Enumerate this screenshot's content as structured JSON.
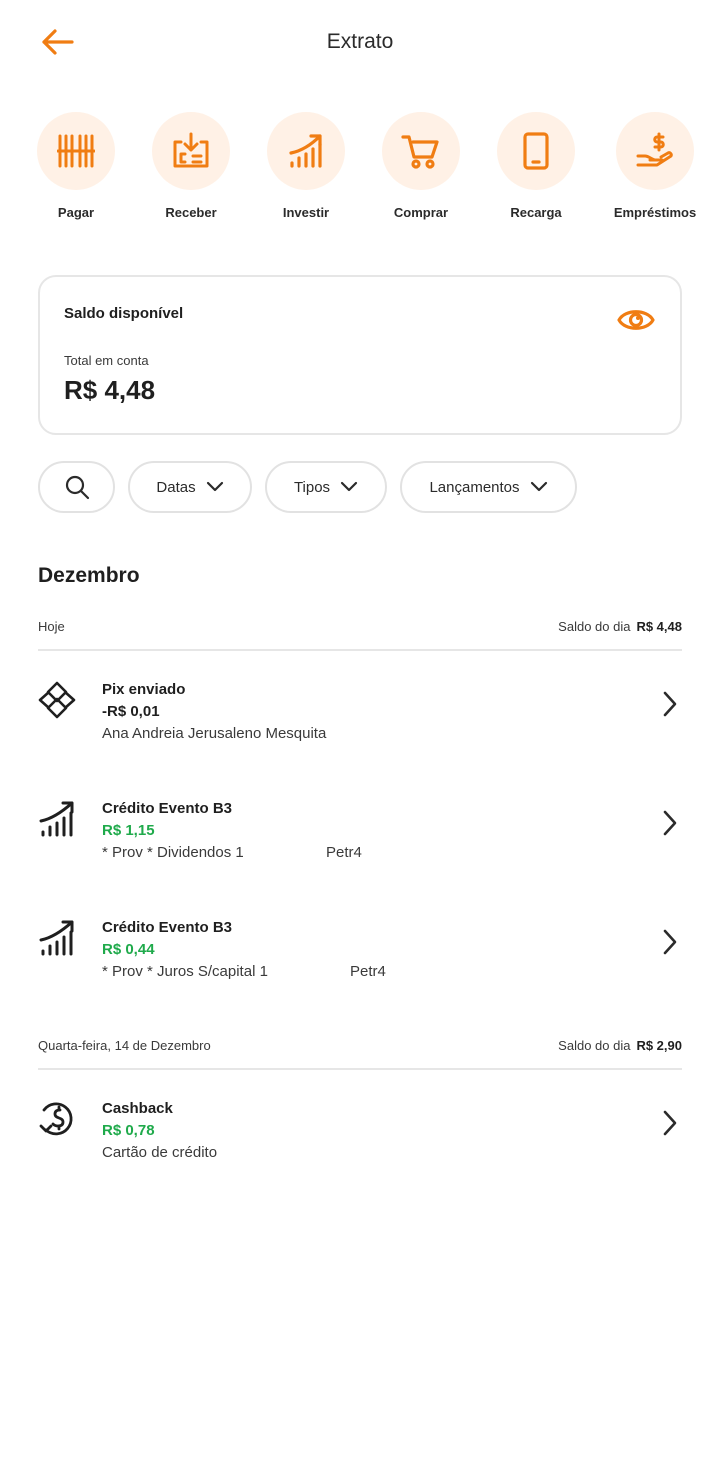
{
  "header": {
    "title": "Extrato"
  },
  "colors": {
    "accent": "#f07d13",
    "accent_bg": "#fff1e6",
    "positive": "#1faa4b",
    "border": "#e6e6e6"
  },
  "actions": [
    {
      "label": "Pagar",
      "icon": "barcode-icon"
    },
    {
      "label": "Receber",
      "icon": "receive-money-icon"
    },
    {
      "label": "Investir",
      "icon": "growth-chart-icon"
    },
    {
      "label": "Comprar",
      "icon": "cart-icon"
    },
    {
      "label": "Recarga",
      "icon": "phone-icon"
    },
    {
      "label": "Empréstimos",
      "icon": "hand-money-icon"
    }
  ],
  "balance": {
    "title": "Saldo disponível",
    "subtitle": "Total em conta",
    "value": "R$ 4,48",
    "icon": "eye-icon"
  },
  "filters": {
    "search_icon": "search-icon",
    "dates": "Datas",
    "types": "Tipos",
    "entries": "Lançamentos"
  },
  "statement": {
    "month": "Dezembro",
    "days": [
      {
        "label": "Hoje",
        "balance_label": "Saldo do dia",
        "balance_value": "R$ 4,48",
        "transactions": [
          {
            "title": "Pix enviado",
            "amount": "-R$ 0,01",
            "desc": "Ana Andreia Jerusaleno Mesquita",
            "extra": "",
            "icon": "pix-icon"
          },
          {
            "title": "Crédito Evento B3",
            "amount": "R$ 1,15",
            "desc": "* Prov * Dividendos 1",
            "extra": "Petr4",
            "icon": "growth-chart-icon"
          },
          {
            "title": "Crédito Evento B3",
            "amount": "R$ 0,44",
            "desc": "* Prov * Juros S/capital 1",
            "extra": "Petr4",
            "icon": "growth-chart-icon"
          }
        ]
      },
      {
        "label": "Quarta-feira, 14 de Dezembro",
        "balance_label": "Saldo do dia",
        "balance_value": "R$ 2,90",
        "transactions": [
          {
            "title": "Cashback",
            "amount": "R$ 0,78",
            "desc": "Cartão de crédito",
            "extra": "",
            "icon": "cashback-icon"
          }
        ]
      }
    ]
  }
}
